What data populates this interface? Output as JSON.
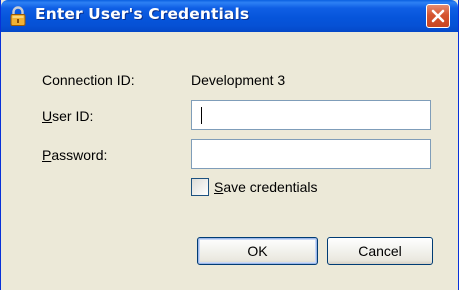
{
  "window": {
    "title": "Enter User's Credentials",
    "icon": "lock-icon",
    "close_icon": "close-icon"
  },
  "form": {
    "connection_id": {
      "label": "Connection ID:",
      "value": "Development 3"
    },
    "user_id": {
      "label_mnemonic": "U",
      "label_rest": "ser ID:",
      "value": ""
    },
    "password": {
      "label_mnemonic": "P",
      "label_rest": "assword:",
      "value": ""
    },
    "save_credentials": {
      "label_mnemonic": "S",
      "label_rest": "ave credentials",
      "checked": false
    }
  },
  "buttons": {
    "ok_label": "OK",
    "cancel_label": "Cancel"
  },
  "colors": {
    "titlebar": "#0655DB",
    "window_bg": "#ECE9D8",
    "close_button": "#D55530",
    "button_border": "#003C74"
  }
}
